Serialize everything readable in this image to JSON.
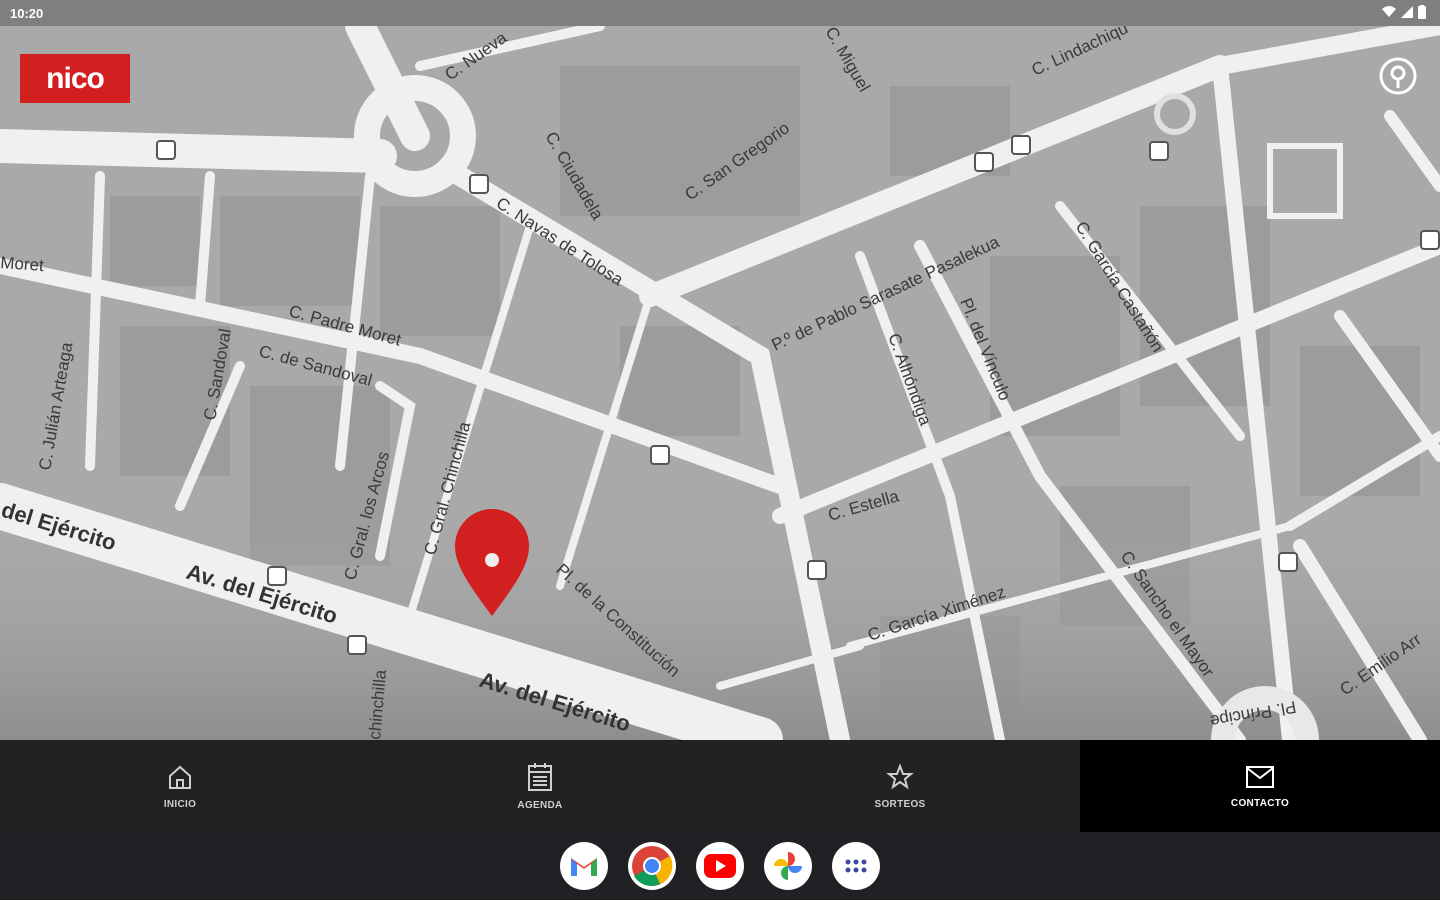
{
  "status_bar": {
    "time": "10:20"
  },
  "app": {
    "logo_text": "nico"
  },
  "map": {
    "streets": [
      "C. Nueva",
      "C. Miguel",
      "C. Lindachiqu",
      "C. San Gregorio",
      "C. Ciudadela",
      "C. Navas de Tolosa",
      "Moret",
      "C. Padre Moret",
      "C. de Sandoval",
      "C. Sandoval",
      "C. Julián Arteaga",
      "P.º de Pablo Sarasate Pasalekua",
      "C. García Castañón",
      "C. Alhóndiga",
      "Pl. del Vínculo",
      "C. Estella",
      "C. Gral. los Arcos",
      "C. Gral. Chinchilla",
      "Pl. de la Constitución",
      "C. García Ximénez",
      "C. Sancho el Mayor",
      "C. Emilio Arr",
      "Pl. Príncipe",
      "del Ejército",
      "Av. del Ejército",
      "Av. del Ejército",
      "chinchilla"
    ]
  },
  "bottom_nav": [
    {
      "label": "INICIO",
      "icon": "home-icon"
    },
    {
      "label": "AGENDA",
      "icon": "calendar-icon"
    },
    {
      "label": "SORTEOS",
      "icon": "star-icon"
    },
    {
      "label": "CONTACTO",
      "icon": "mail-icon"
    }
  ],
  "taskbar": {
    "apps": [
      "gmail-icon",
      "chrome-icon",
      "youtube-icon",
      "photos-icon",
      "app-drawer-icon"
    ]
  },
  "colors": {
    "accent": "#d21f1f",
    "map_bg": "#a9a9a9",
    "road": "#f2f2f2"
  }
}
